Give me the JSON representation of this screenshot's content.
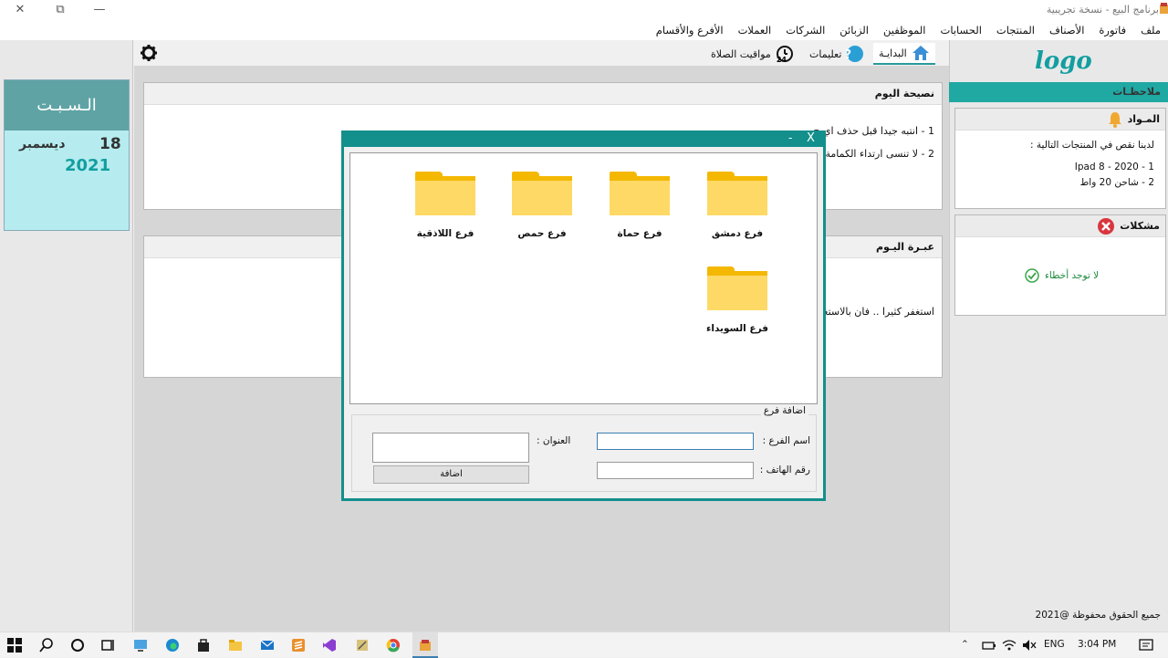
{
  "window": {
    "title": "برنامج البيع - نسخة تجريبية",
    "min": "—",
    "max": "⧉",
    "close": "✕"
  },
  "menu": [
    "ملف",
    "فاتورة",
    "الأصناف",
    "المنتجات",
    "الحسابات",
    "الموظفين",
    "الزبائن",
    "الشركات",
    "العملات",
    "الأفرع والأقسام"
  ],
  "date": {
    "day": "الـسـبـت",
    "num": "18",
    "month": "ديسمبر",
    "year": "2021"
  },
  "tabs": {
    "home": "البدايـة",
    "help": "تعليمات",
    "prayer": "مواقيت الصلاة"
  },
  "advice": {
    "title": "نصيحة اليوم",
    "line1": "1 - انتبه جيدا قبل حذف اي ح",
    "line2": "2 - لا تنسى ارتداء الكمامة و"
  },
  "quote": {
    "title": "عبـرة اليـوم",
    "line1": "استغفر كثيرا .. فان بالاستغف"
  },
  "logo": "logo",
  "notes": {
    "title": "ملاحظـات",
    "materials": {
      "title": "المـواد",
      "intro": "لدينا نقص في المنتجات التالية :",
      "items": [
        "Ipad 8 - 2020 - 1",
        "2 - شاحن 20 واط"
      ]
    },
    "problems": {
      "title": "مشكلات",
      "status": "لا توجد أخطاء"
    }
  },
  "footer": "جميع الحقوق محفوظة @2021",
  "dialog": {
    "title": "",
    "min": "-",
    "close": "X",
    "folders": [
      "فرع دمشق",
      "فرع حماة",
      "فرع حمص",
      "فرع اللاذقية",
      "فرع السويداء"
    ],
    "add_group": "اضافة فرع",
    "branch_name_label": "اسم الفرع :",
    "phone_label": "رقم الهاتف :",
    "address_label": "العنوان :",
    "branch_name_value": "",
    "phone_value": "",
    "address_value": "",
    "add_button": "اضافة"
  },
  "taskbar": {
    "lang": "ENG",
    "time": "3:04 PM"
  },
  "colors": {
    "accent": "#20a8a3",
    "dialog_border": "#138f8c",
    "date_bg": "#b6ecef",
    "folder": "#ffd966"
  }
}
